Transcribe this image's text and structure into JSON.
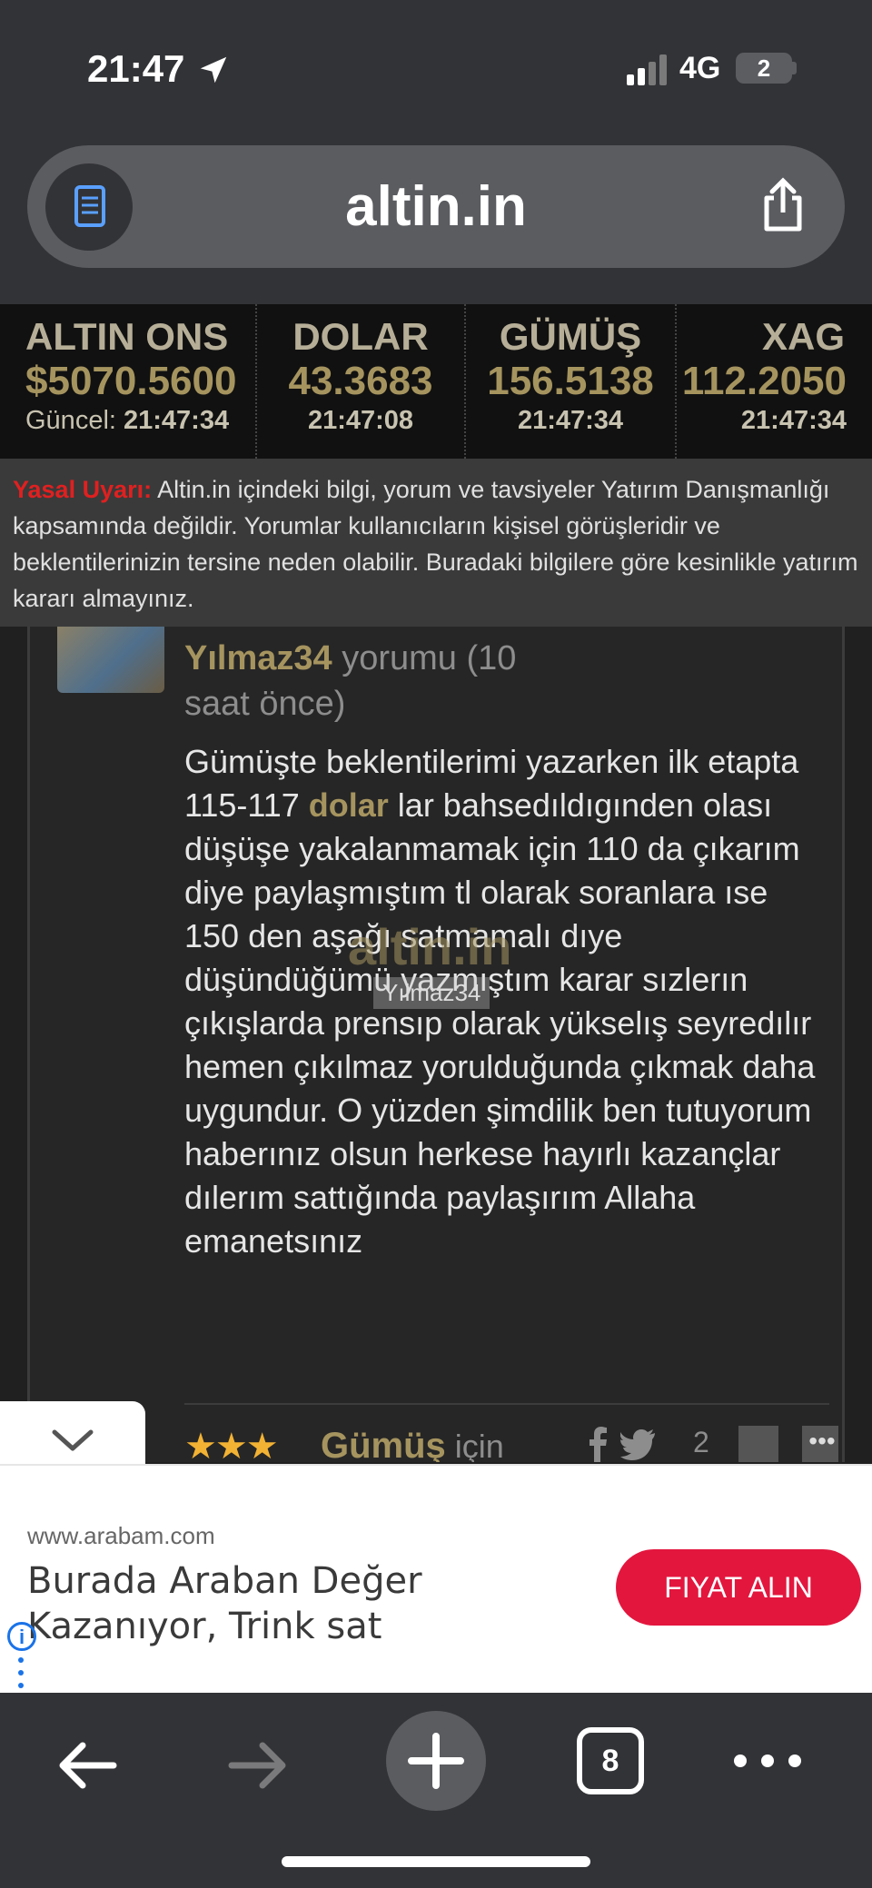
{
  "status": {
    "time": "21:47",
    "network": "4G",
    "battery": "2"
  },
  "browser": {
    "url": "altin.in",
    "tabs_count": "8"
  },
  "ticker": [
    {
      "name": "ALTIN ONS",
      "value": "$5070.5600",
      "time_label": "Güncel:",
      "time": "21:47:34"
    },
    {
      "name": "DOLAR",
      "value": "43.3683",
      "time_label": "",
      "time": "21:47:08"
    },
    {
      "name": "GÜMÜŞ",
      "value": "156.5138",
      "time_label": "",
      "time": "21:47:34"
    },
    {
      "name": "XAG",
      "value": "112.2050",
      "time_label": "",
      "time": "21:47:34"
    }
  ],
  "warning": {
    "label": "Yasal Uyarı:",
    "text": " Altin.in içindeki bilgi, yorum ve tavsiyeler Yatırım Danışmanlığı kapsamında değildir. Yorumlar kullanıcıların kişisel görüşleridir ve beklentilerinizin tersine neden olabilir. Buradaki bilgilere göre kesinlikle yatırım kararı almayınız."
  },
  "comment": {
    "author": "Yılmaz34",
    "meta": " yorumu (10 saat önce)",
    "text_before": "Gümüşte beklentilerimi yazarken ilk etapta 115-117 ",
    "highlight": "dolar",
    "text_after": " lar bahsedıldıgınden olası düşüşe yakalanmamak için 110 da çıkarım diye paylaşmıştım tl olarak soranlara ıse 150 den aşağı satmamalı dıye düşündüğümü yazmıştım karar sızlerın çıkışlarda prensıp olarak yükselış seyredılır hemen çıkılmaz yorulduğunda çıkmak daha uygundur. O yüzden şimdilik ben tutuyorum haberınız olsun herkese hayırlı kazançlar dılerım sattığında paylaşırım Allaha emanetsınız",
    "watermark": "altin.in",
    "watermark_user": "Yılmaz34"
  },
  "next_comment": {
    "stars": "★★★",
    "title": "Gümüş",
    "title_suffix": " için",
    "count": "2",
    "more": "•••"
  },
  "ad": {
    "url": "www.arabam.com",
    "headline": "Burada Araban Değer Kazanıyor, Trink sat Merkezimize Bekleriz",
    "cta": "FIYAT ALIN",
    "info": "i",
    "cta_color": "#e3163e"
  },
  "icons": [
    "location-arrow-icon",
    "signal-icon",
    "reader-icon",
    "share-icon",
    "chevron-down-icon",
    "back-icon",
    "forward-icon",
    "plus-icon",
    "tabs-icon",
    "more-icon",
    "facebook-icon",
    "twitter-icon",
    "thumbs-up-icon",
    "info-icon"
  ]
}
